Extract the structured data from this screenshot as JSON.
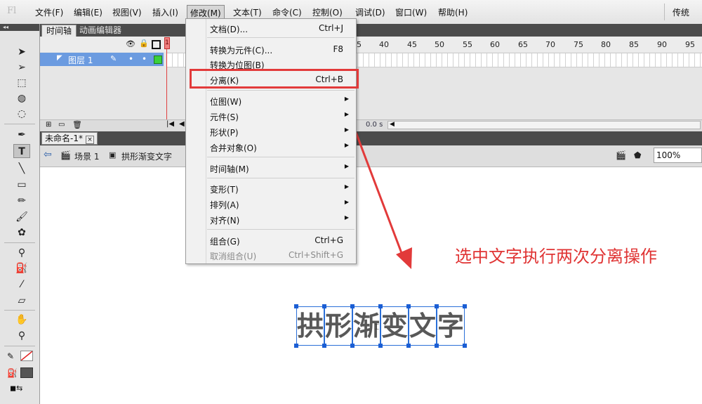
{
  "app": {
    "logo": "Fl",
    "workspace": "传统"
  },
  "menubar": {
    "items": [
      {
        "label": "文件(F)"
      },
      {
        "label": "编辑(E)"
      },
      {
        "label": "视图(V)"
      },
      {
        "label": "插入(I)"
      },
      {
        "label": "修改(M)"
      },
      {
        "label": "文本(T)"
      },
      {
        "label": "命令(C)"
      },
      {
        "label": "控制(O)"
      },
      {
        "label": "调试(D)"
      },
      {
        "label": "窗口(W)"
      },
      {
        "label": "帮助(H)"
      }
    ]
  },
  "timeline": {
    "tabs": [
      {
        "label": "时间轴"
      },
      {
        "label": "动画编辑器"
      }
    ],
    "playhead_frame": "1",
    "ruler": [
      "5",
      "40",
      "45",
      "50",
      "55",
      "60",
      "65",
      "70",
      "75",
      "80",
      "85",
      "90",
      "95"
    ],
    "layer_name": "图层 1",
    "fps_time": "0.0 s"
  },
  "document": {
    "tab_label": "未命名-1*",
    "close": "×"
  },
  "editbar": {
    "scene": "场景 1",
    "symbol": "拱形渐变文字",
    "zoom": "100%"
  },
  "menu": {
    "items": [
      {
        "label": "文档(D)...",
        "shortcut": "Ctrl+J"
      },
      {
        "label": "转换为元件(C)...",
        "shortcut": "F8"
      },
      {
        "label": "转换为位图(B)",
        "shortcut": ""
      },
      {
        "label": "分离(K)",
        "shortcut": "Ctrl+B"
      },
      {
        "label": "位图(W)",
        "submenu": true
      },
      {
        "label": "元件(S)",
        "submenu": true
      },
      {
        "label": "形状(P)",
        "submenu": true
      },
      {
        "label": "合并对象(O)",
        "submenu": true
      },
      {
        "label": "时间轴(M)",
        "submenu": true
      },
      {
        "label": "变形(T)",
        "submenu": true
      },
      {
        "label": "排列(A)",
        "submenu": true
      },
      {
        "label": "对齐(N)",
        "submenu": true
      },
      {
        "label": "组合(G)",
        "shortcut": "Ctrl+G"
      },
      {
        "label": "取消组合(U)",
        "shortcut": "Ctrl+Shift+G",
        "disabled": true
      }
    ],
    "submenu_arrow": "▶"
  },
  "stage": {
    "glyphs": [
      "拱",
      "形",
      "渐",
      "变",
      "文",
      "字"
    ],
    "annotation": "选中文字执行两次分离操作"
  },
  "colors": {
    "annotation": "#e03434",
    "highlight": "#e23a3a",
    "selection": "#2a6fd8"
  }
}
